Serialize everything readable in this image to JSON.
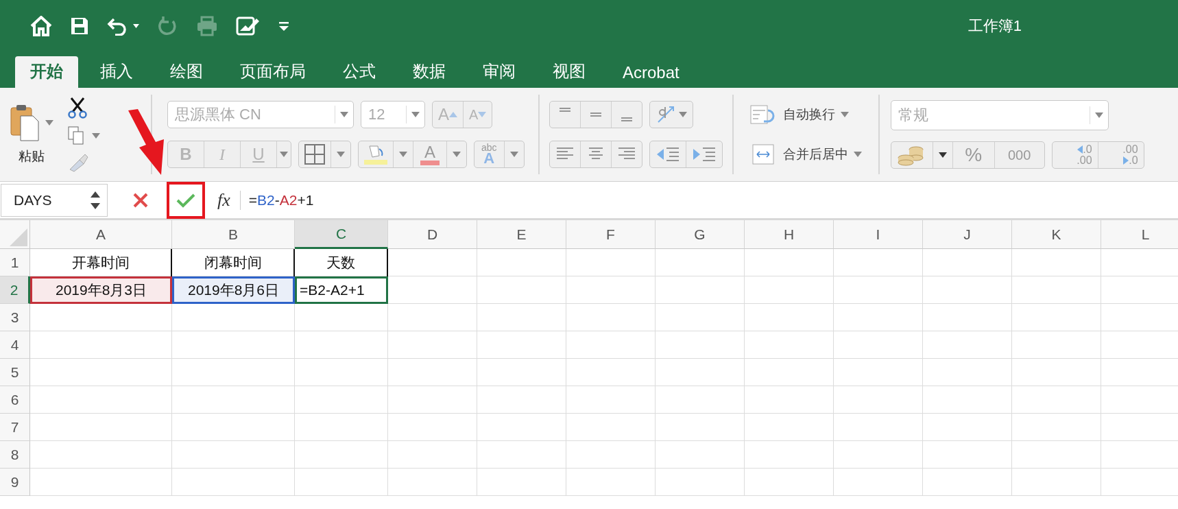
{
  "title": "工作簿1",
  "quick_access": [
    {
      "kind": "home",
      "disabled": false
    },
    {
      "kind": "save",
      "disabled": false
    },
    {
      "kind": "undo",
      "disabled": false
    },
    {
      "kind": "redo",
      "disabled": true
    },
    {
      "kind": "print",
      "disabled": true
    },
    {
      "kind": "edit",
      "disabled": false
    },
    {
      "kind": "customize",
      "disabled": false
    }
  ],
  "tabs": [
    {
      "label": "开始",
      "selected": true
    },
    {
      "label": "插入",
      "selected": false
    },
    {
      "label": "绘图",
      "selected": false
    },
    {
      "label": "页面布局",
      "selected": false
    },
    {
      "label": "公式",
      "selected": false
    },
    {
      "label": "数据",
      "selected": false
    },
    {
      "label": "审阅",
      "selected": false
    },
    {
      "label": "视图",
      "selected": false
    },
    {
      "label": "Acrobat",
      "selected": false
    }
  ],
  "ribbon": {
    "paste": "粘贴",
    "font": {
      "disabled": true,
      "name": "思源黑体 CN",
      "size": "12",
      "grow": "A",
      "shrink": "A",
      "bold": "B",
      "italic": "I",
      "underline": "U",
      "font_color": "A",
      "styles": [
        "abc",
        "A"
      ]
    },
    "wrap_text": "自动换行",
    "merge": "合并后居中",
    "number_format": {
      "value": "常规",
      "disabled": true
    },
    "percent": "%",
    "comma": "000",
    "add_decimal": [
      ".0",
      ".00"
    ],
    "remove_decimal": [
      ".00",
      ".0"
    ]
  },
  "formula_bar": {
    "name_box": "DAYS",
    "enter_highlighted": true,
    "fx": "fx",
    "tokens": [
      {
        "text": "=",
        "kind": "plain"
      },
      {
        "text": "B2",
        "kind": "ref",
        "color": "#2e62c8"
      },
      {
        "text": "-",
        "kind": "plain"
      },
      {
        "text": "A2",
        "kind": "ref",
        "color": "#c4313b"
      },
      {
        "text": "+1",
        "kind": "plain"
      }
    ]
  },
  "sheet": {
    "columns": [
      {
        "label": "A",
        "selected": false
      },
      {
        "label": "B",
        "selected": false
      },
      {
        "label": "C",
        "selected": true
      },
      {
        "label": "D",
        "selected": false
      },
      {
        "label": "E",
        "selected": false
      },
      {
        "label": "F",
        "selected": false
      },
      {
        "label": "G",
        "selected": false
      },
      {
        "label": "H",
        "selected": false
      },
      {
        "label": "I",
        "selected": false
      },
      {
        "label": "J",
        "selected": false
      },
      {
        "label": "K",
        "selected": false
      },
      {
        "label": "L",
        "selected": false
      }
    ],
    "rows": [
      {
        "label": "1",
        "selected": false,
        "cells": [
          {
            "text": "开幕时间",
            "bordered": true
          },
          {
            "text": "闭幕时间",
            "bordered": true
          },
          {
            "text": "天数",
            "bordered": true
          }
        ]
      },
      {
        "label": "2",
        "selected": true,
        "cells": [
          {
            "text": "2019年8月3日",
            "color": "#c4313b"
          },
          {
            "text": "2019年8月6日",
            "color": "#2e62c8"
          },
          {
            "text": "=B2-A2+1",
            "active": true
          }
        ]
      },
      {
        "label": "3",
        "selected": false,
        "cells": []
      },
      {
        "label": "4",
        "selected": false,
        "cells": []
      },
      {
        "label": "5",
        "selected": false,
        "cells": []
      },
      {
        "label": "6",
        "selected": false,
        "cells": []
      },
      {
        "label": "7",
        "selected": false,
        "cells": []
      },
      {
        "label": "8",
        "selected": false,
        "cells": []
      },
      {
        "label": "9",
        "selected": false,
        "cells": []
      }
    ]
  }
}
